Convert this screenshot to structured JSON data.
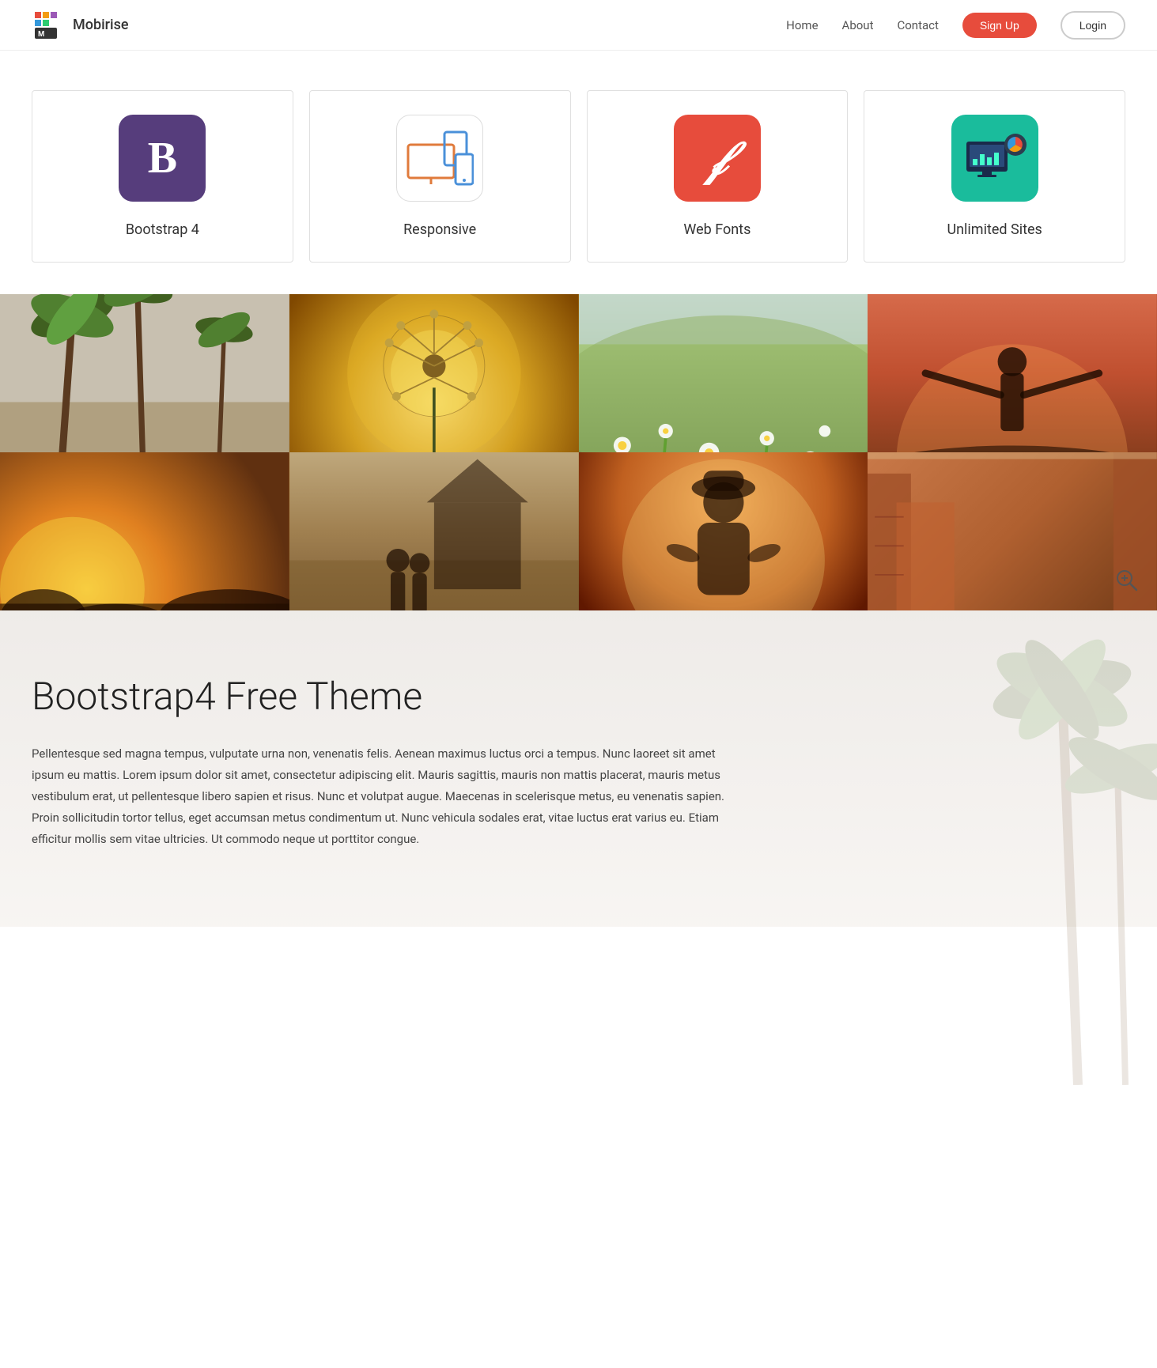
{
  "brand": {
    "name": "Mobirise"
  },
  "navbar": {
    "links": [
      {
        "label": "Home",
        "id": "home"
      },
      {
        "label": "About",
        "id": "about"
      },
      {
        "label": "Contact",
        "id": "contact"
      }
    ],
    "signup_label": "Sign Up",
    "login_label": "Login"
  },
  "features": [
    {
      "id": "bootstrap",
      "title": "Bootstrap 4",
      "icon_type": "bootstrap"
    },
    {
      "id": "responsive",
      "title": "Responsive",
      "icon_type": "responsive"
    },
    {
      "id": "webfonts",
      "title": "Web Fonts",
      "icon_type": "webfonts"
    },
    {
      "id": "unlimited",
      "title": "Unlimited Sites",
      "icon_type": "unlimited"
    }
  ],
  "gallery": {
    "zoom_icon_label": "zoom-in"
  },
  "content": {
    "title": "Bootstrap4 Free Theme",
    "body": "Pellentesque sed magna tempus, vulputate urna non, venenatis felis. Aenean maximus luctus orci a tempus. Nunc laoreet sit amet ipsum eu mattis. Lorem ipsum dolor sit amet, consectetur adipiscing elit. Mauris sagittis, mauris non mattis placerat, mauris metus vestibulum erat, ut pellentesque libero sapien et risus. Nunc et volutpat augue. Maecenas in scelerisque metus, eu venenatis sapien. Proin sollicitudin tortor tellus, eget accumsan metus condimentum ut. Nunc vehicula sodales erat, vitae luctus erat varius eu. Etiam efficitur mollis sem vitae ultricies. Ut commodo neque ut porttitor congue."
  }
}
